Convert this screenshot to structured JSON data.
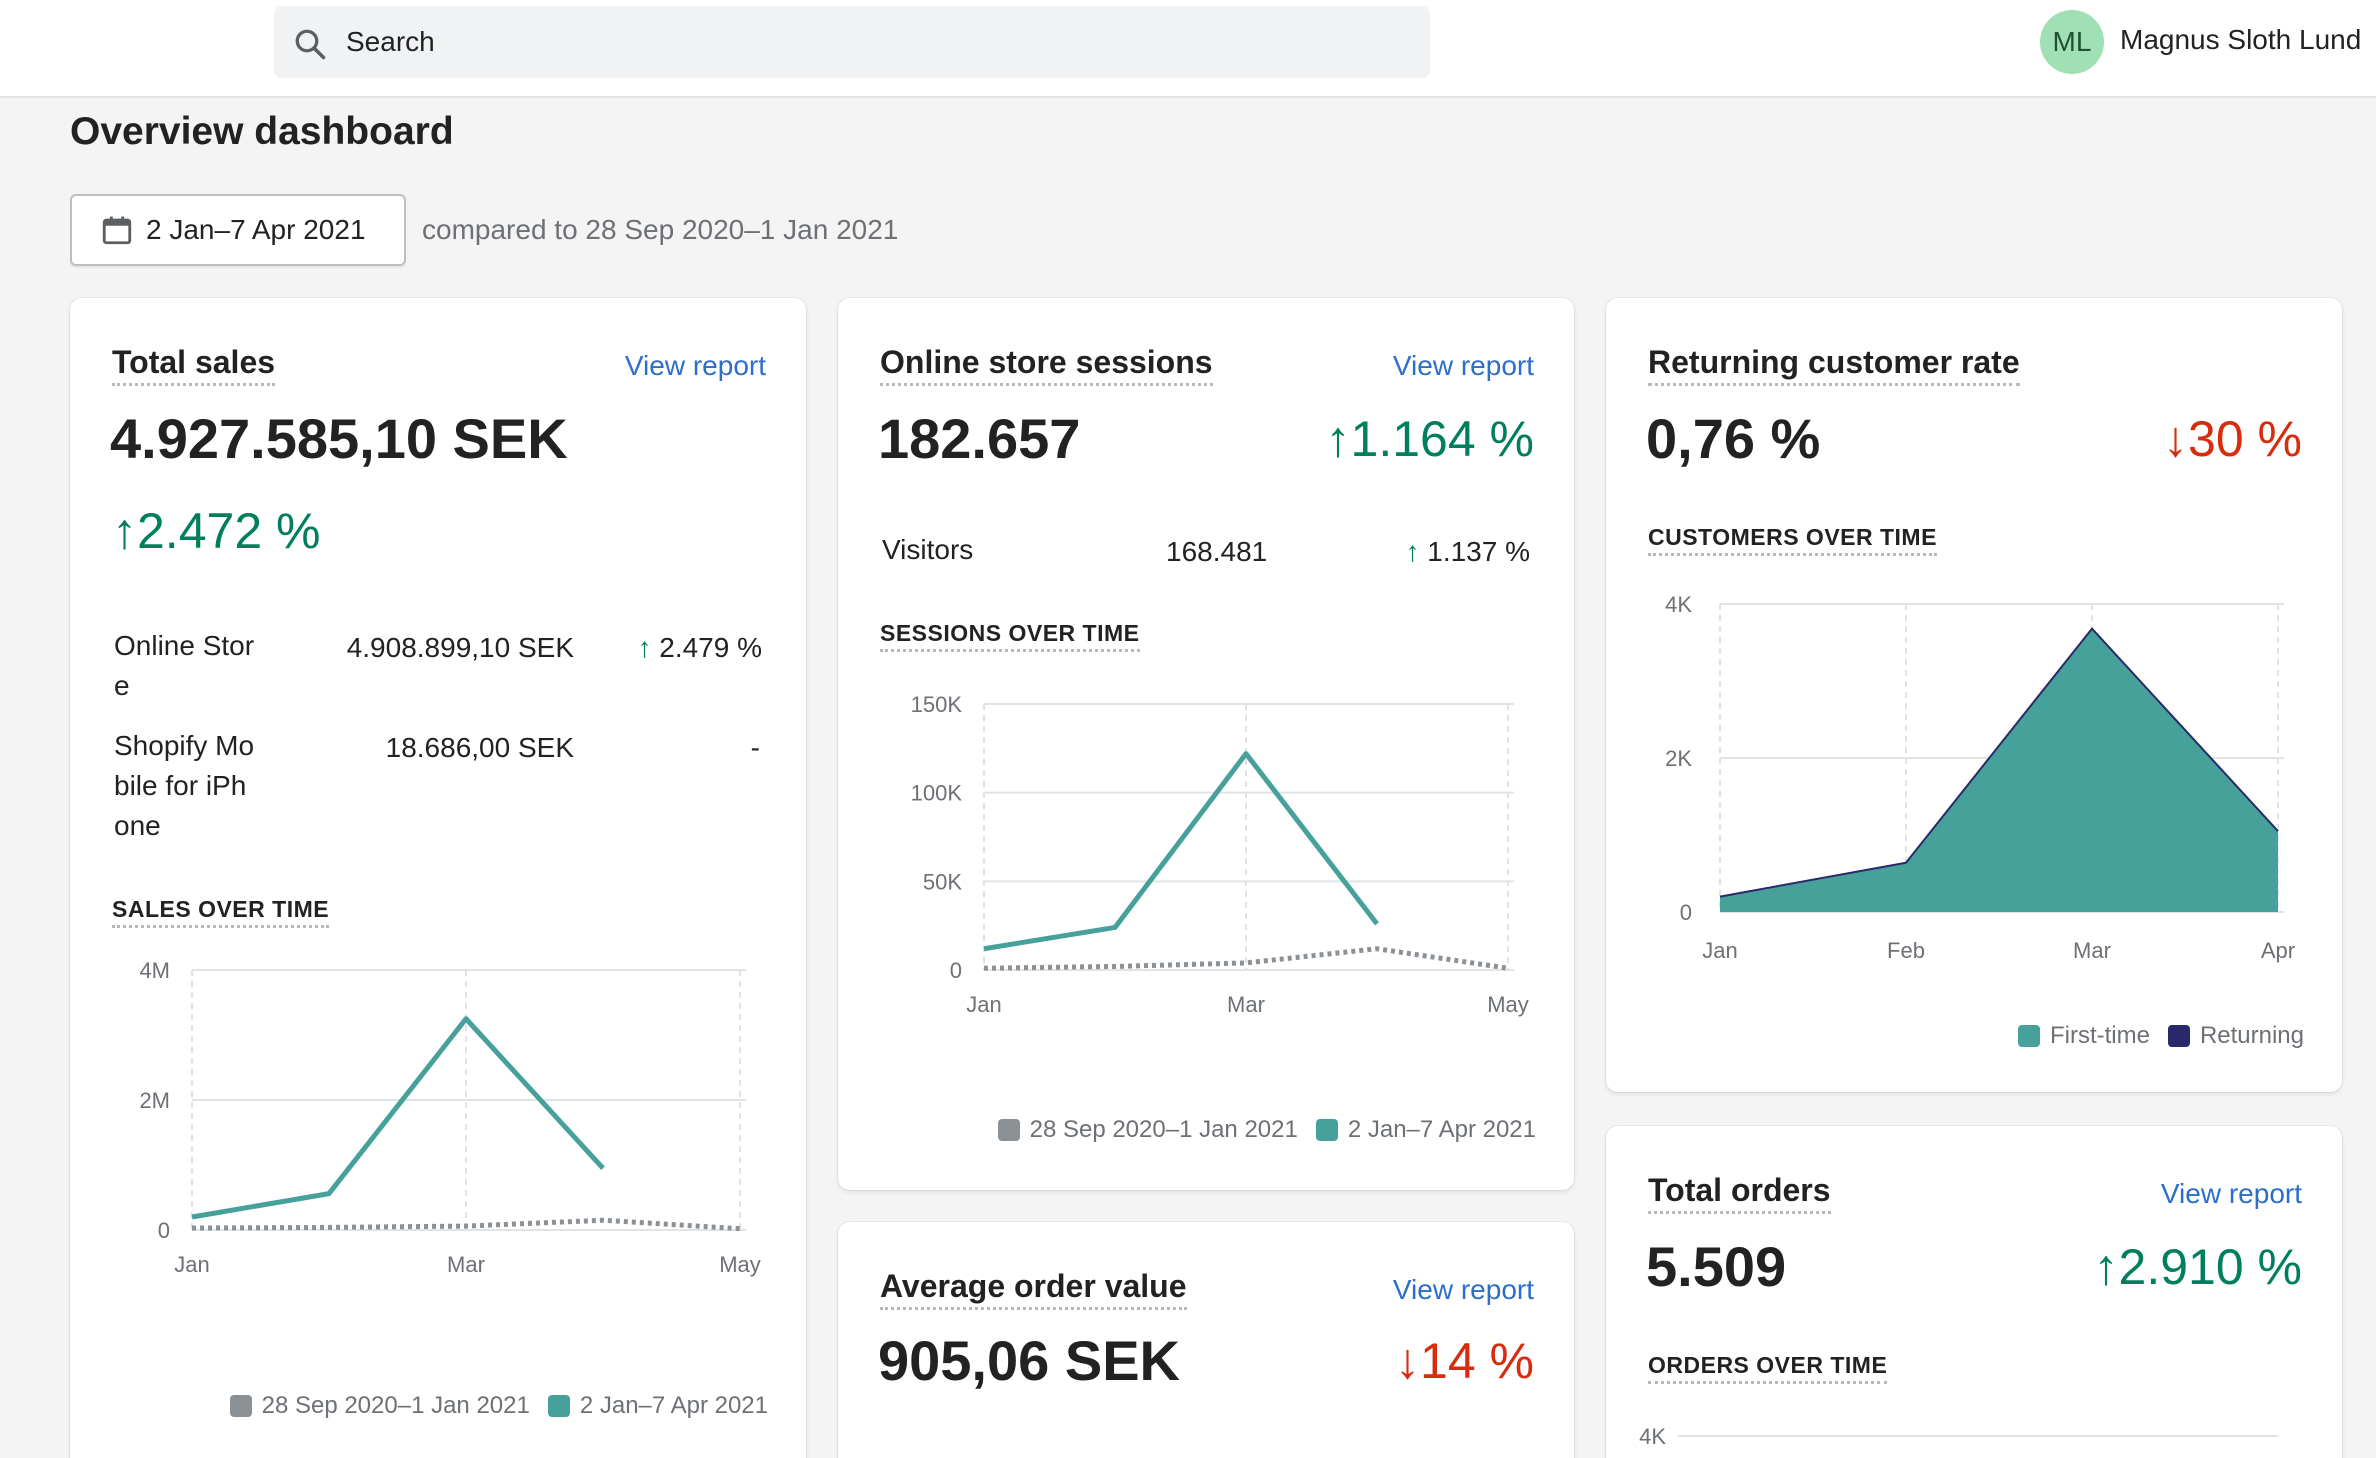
{
  "header": {
    "search_placeholder": "Search",
    "avatar_initials": "ML",
    "user_name": "Magnus Sloth Lund"
  },
  "page": {
    "title": "Overview dashboard",
    "date_range": "2 Jan–7 Apr 2021",
    "compared_to": "compared to 28 Sep 2020–1 Jan 2021"
  },
  "total_sales": {
    "title": "Total sales",
    "view_report": "View report",
    "value": "4.927.585,10 SEK",
    "delta_arrow": "↑",
    "delta": "2.472 %",
    "breakdown": [
      {
        "channel": "Online Stor e",
        "line1": "Online Stor",
        "line2": "e",
        "amount": "4.908.899,10 SEK",
        "arrow": "↑",
        "change": "2.479 %"
      },
      {
        "channel": "Shopify Mo bile for iPh one",
        "line1": "Shopify Mo",
        "line2": "bile for iPh",
        "line3": "one",
        "amount": "18.686,00 SEK",
        "change": "-"
      }
    ],
    "chart_label": "SALES OVER TIME",
    "legend": [
      "28 Sep 2020–1 Jan 2021",
      "2 Jan–7 Apr 2021"
    ]
  },
  "sessions": {
    "title": "Online store sessions",
    "view_report": "View report",
    "value": "182.657",
    "delta_arrow": "↑",
    "delta": "1.164 %",
    "visitors_label": "Visitors",
    "visitors_value": "168.481",
    "visitors_arrow": "↑",
    "visitors_change": "1.137 %",
    "chart_label": "SESSIONS OVER TIME",
    "legend": [
      "28 Sep 2020–1 Jan 2021",
      "2 Jan–7 Apr 2021"
    ]
  },
  "returning": {
    "title": "Returning customer rate",
    "value": "0,76 %",
    "delta_arrow": "↓",
    "delta": "30 %",
    "chart_label": "CUSTOMERS OVER TIME",
    "legend": [
      "First-time",
      "Returning"
    ]
  },
  "aov": {
    "title": "Average order value",
    "view_report": "View report",
    "value": "905,06 SEK",
    "delta_arrow": "↓",
    "delta": "14 %"
  },
  "orders": {
    "title": "Total orders",
    "view_report": "View report",
    "value": "5.509",
    "delta_arrow": "↑",
    "delta": "2.910 %",
    "chart_label": "ORDERS OVER TIME",
    "y_tick_top": "4K"
  },
  "colors": {
    "current": "#47a19b",
    "previous": "#8c9196",
    "first_time": "#47a19b",
    "returning": "#292969",
    "up": "#007f5f",
    "down": "#d72c0d",
    "link": "#2c6ecb"
  },
  "chart_data": [
    {
      "type": "line",
      "title": "SALES OVER TIME",
      "x_ticks": [
        "Jan",
        "Mar",
        "May"
      ],
      "y_ticks": [
        "0",
        "2M",
        "4M"
      ],
      "ylim": [
        0,
        4000000
      ],
      "x_positions_months": [
        0,
        1,
        2,
        3,
        4
      ],
      "series": [
        {
          "name": "2 Jan–7 Apr 2021",
          "x": [
            0,
            1,
            2,
            3
          ],
          "values": [
            200000,
            560000,
            3250000,
            950000
          ]
        },
        {
          "name": "28 Sep 2020–1 Jan 2021",
          "x": [
            0,
            1,
            2,
            3,
            4
          ],
          "values": [
            30000,
            40000,
            60000,
            150000,
            20000
          ]
        }
      ],
      "legend_position": "bottom-right"
    },
    {
      "type": "line",
      "title": "SESSIONS OVER TIME",
      "x_ticks": [
        "Jan",
        "Mar",
        "May"
      ],
      "y_ticks": [
        "0",
        "50K",
        "100K",
        "150K"
      ],
      "ylim": [
        0,
        150000
      ],
      "series": [
        {
          "name": "2 Jan–7 Apr 2021",
          "x": [
            0,
            1,
            2,
            3
          ],
          "values": [
            12000,
            24000,
            122000,
            26000
          ]
        },
        {
          "name": "28 Sep 2020–1 Jan 2021",
          "x": [
            0,
            1,
            2,
            3,
            4
          ],
          "values": [
            1000,
            2000,
            4000,
            12000,
            1000
          ]
        }
      ],
      "legend_position": "bottom-right"
    },
    {
      "type": "area",
      "title": "CUSTOMERS OVER TIME",
      "categories": [
        "Jan",
        "Feb",
        "Mar",
        "Apr"
      ],
      "y_ticks": [
        "0",
        "2K",
        "4K"
      ],
      "ylim": [
        0,
        4000
      ],
      "series": [
        {
          "name": "First-time",
          "values": [
            200,
            640,
            3680,
            1050
          ]
        },
        {
          "name": "Returning",
          "values": [
            10,
            20,
            30,
            20
          ]
        }
      ],
      "legend_position": "bottom-right"
    }
  ]
}
